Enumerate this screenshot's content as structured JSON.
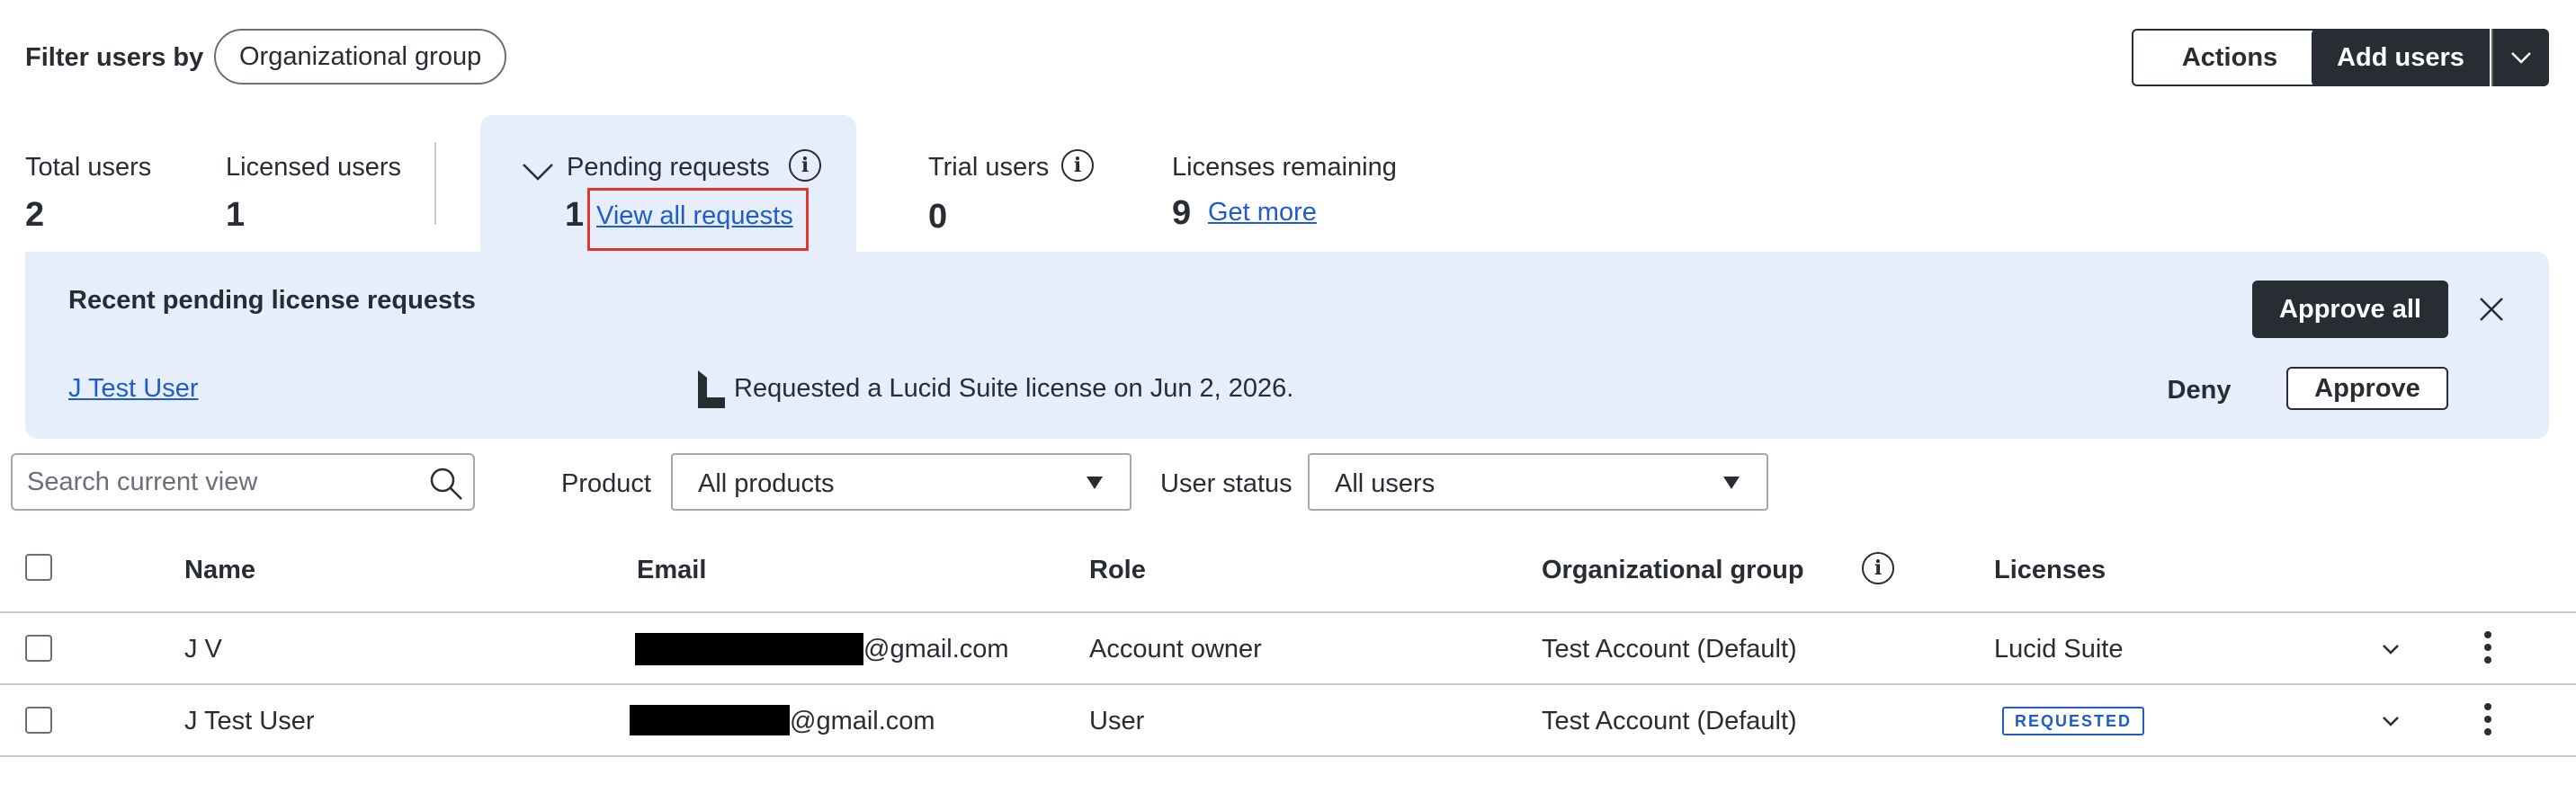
{
  "filter_bar": {
    "label": "Filter users by",
    "org_group_button": "Organizational group",
    "actions_button": "Actions",
    "add_users_button": "Add users"
  },
  "stats": {
    "total_users_label": "Total users",
    "total_users_value": "2",
    "licensed_users_label": "Licensed users",
    "licensed_users_value": "1",
    "pending_requests_label": "Pending requests",
    "pending_requests_value": "1",
    "view_all_requests_link": "View all requests",
    "trial_users_label": "Trial users",
    "trial_users_value": "0",
    "licenses_remaining_label": "Licenses remaining",
    "licenses_remaining_value": "9",
    "get_more_link": "Get more"
  },
  "banner": {
    "title": "Recent pending license requests",
    "approve_all_button": "Approve all",
    "request": {
      "user": "J Test User",
      "text": "Requested a Lucid Suite license on Jun 2, 2026.",
      "deny_button": "Deny",
      "approve_button": "Approve"
    }
  },
  "filters": {
    "search_placeholder": "Search current view",
    "product_label": "Product",
    "product_value": "All products",
    "user_status_label": "User status",
    "user_status_value": "All users"
  },
  "table": {
    "columns": [
      "Name",
      "Email",
      "Role",
      "Organizational group",
      "Licenses"
    ],
    "rows": [
      {
        "name": "J V",
        "email_suffix": "@gmail.com",
        "role": "Account owner",
        "org_group": "Test Account (Default)",
        "license": "Lucid Suite"
      },
      {
        "name": "J Test User",
        "email_suffix": "@gmail.com",
        "role": "User",
        "org_group": "Test Account (Default)",
        "license": "REQUESTED"
      }
    ]
  },
  "colors": {
    "accent_dark": "#282c33",
    "link_blue": "#1f5cc9",
    "banner_bg": "#e6eefb",
    "highlight_red": "#e0372b"
  }
}
